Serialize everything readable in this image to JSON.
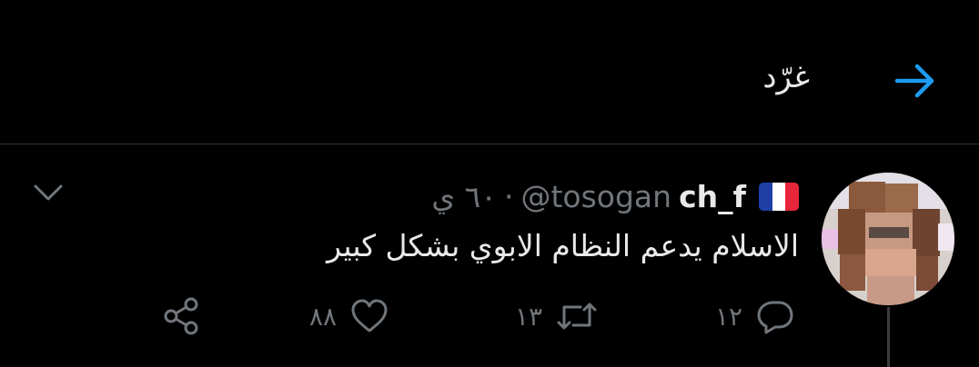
{
  "header": {
    "title": "غرّد",
    "back_icon": "arrow-right-icon"
  },
  "tweet": {
    "name": "ch_f",
    "handle": "@tosogan",
    "separator": "·",
    "time": "٦٠ ي",
    "flag_icon": "france-flag-icon",
    "text": "الاسلام يدعم النظام الابوي بشكل كبير",
    "actions": {
      "replies": "١٢",
      "retweets": "١٣",
      "likes": "٨٨"
    }
  },
  "colors": {
    "accent": "#1d9bf0",
    "muted": "#71767b",
    "text": "#e7e9ea",
    "background": "#000000"
  }
}
